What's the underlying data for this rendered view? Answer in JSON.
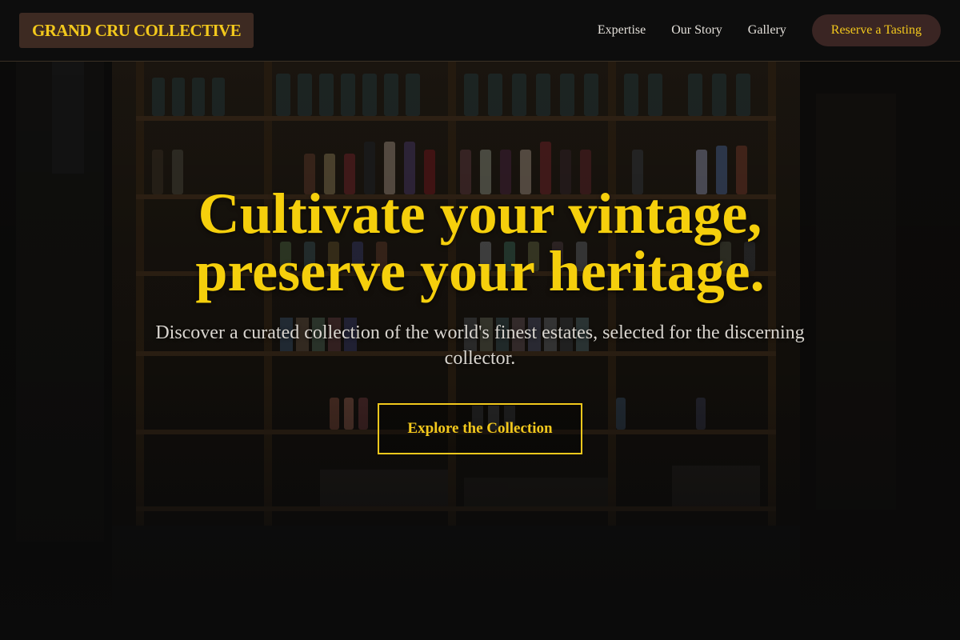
{
  "brand": {
    "name": "GRAND CRU COLLECTIVE"
  },
  "nav": {
    "items": [
      {
        "label": "Expertise"
      },
      {
        "label": "Our Story"
      },
      {
        "label": "Gallery"
      }
    ],
    "cta_label": "Reserve a Tasting"
  },
  "hero": {
    "headline_line1": "Cultivate your vintage,",
    "headline_line2": "preserve your heritage.",
    "subtext": "Discover a curated collection of the world's finest estates, selected for the discerning collector.",
    "button_label": "Explore the Collection",
    "background_image": "wine-shop-shelves"
  },
  "colors": {
    "accent": "#f2c81c",
    "header_bg": "#0d0d0d",
    "logo_bg": "#3d2a22",
    "cta_bg": "#3a2523",
    "nav_text": "#e4e0da"
  }
}
